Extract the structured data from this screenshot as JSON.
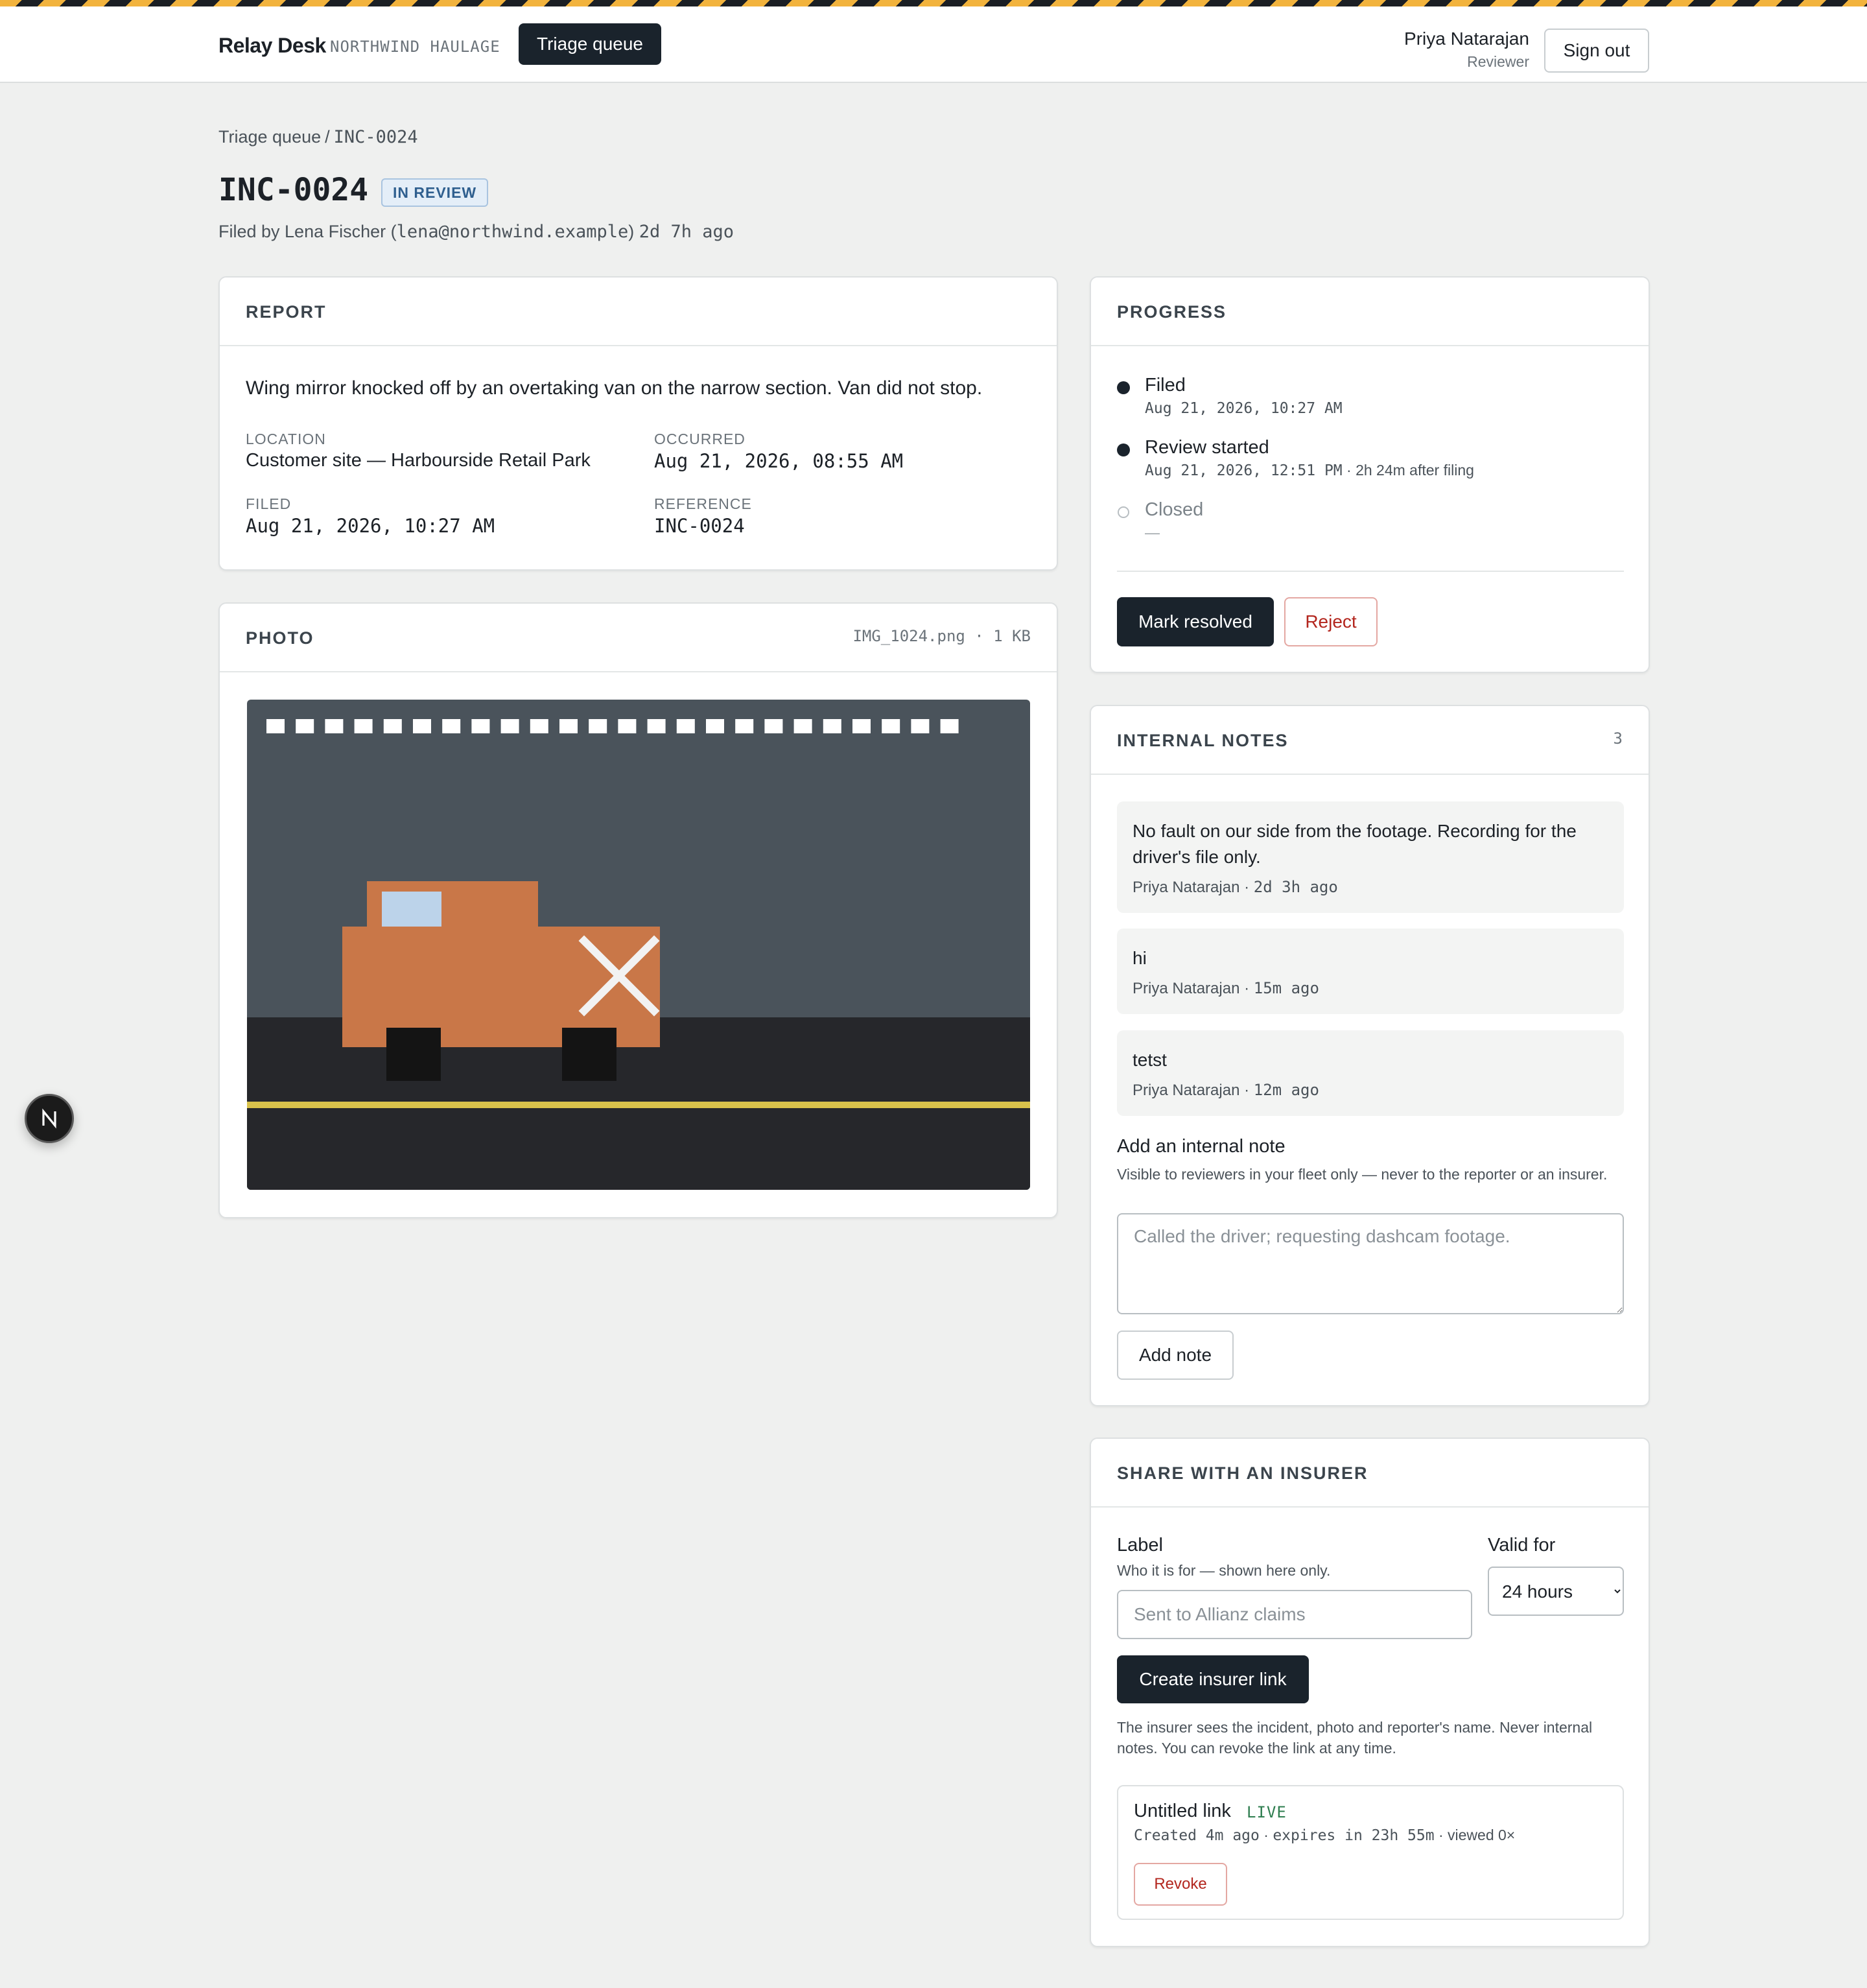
{
  "app": {
    "name": "Relay Desk",
    "org": "NORTHWIND HAULAGE"
  },
  "nav": {
    "triage_queue": "Triage queue"
  },
  "user": {
    "name": "Priya Natarajan",
    "role": "Reviewer",
    "sign_out": "Sign out"
  },
  "breadcrumb": {
    "parent": "Triage queue",
    "separator": "/",
    "current": "INC-0024"
  },
  "incident": {
    "id": "INC-0024",
    "status": "IN REVIEW",
    "filed_by_prefix": "Filed by Lena Fischer (",
    "filed_by_email": "lena@northwind.example",
    "filed_by_suffix": ")",
    "filed_ago": "2d 7h ago"
  },
  "report": {
    "heading": "REPORT",
    "description": "Wing mirror knocked off by an overtaking van on the narrow section. Van did not stop.",
    "fields": {
      "location": {
        "label": "LOCATION",
        "value": "Customer site — Harbourside Retail Park"
      },
      "occurred": {
        "label": "OCCURRED",
        "value": "Aug 21, 2026, 08:55 AM"
      },
      "filed": {
        "label": "FILED",
        "value": "Aug 21, 2026, 10:27 AM"
      },
      "reference": {
        "label": "REFERENCE",
        "value": "INC-0024"
      }
    }
  },
  "photo": {
    "heading": "PHOTO",
    "filename": "IMG_1024.png",
    "size": "1 KB",
    "meta_sep": "·"
  },
  "progress": {
    "heading": "PROGRESS",
    "steps": [
      {
        "title": "Filed",
        "timestamp": "Aug 21, 2026, 10:27 AM",
        "extra": "",
        "done": true
      },
      {
        "title": "Review started",
        "timestamp": "Aug 21, 2026, 12:51 PM",
        "extra": "· 2h 24m after filing",
        "done": true
      },
      {
        "title": "Closed",
        "timestamp": "—",
        "extra": "",
        "done": false
      }
    ],
    "mark_resolved": "Mark resolved",
    "reject": "Reject"
  },
  "notes": {
    "heading": "INTERNAL NOTES",
    "count": "3",
    "items": [
      {
        "text": "No fault on our side from the footage. Recording for the driver's file only.",
        "author": "Priya Natarajan",
        "sep": "·",
        "ago": "2d 3h ago"
      },
      {
        "text": "hi",
        "author": "Priya Natarajan",
        "sep": "·",
        "ago": "15m ago"
      },
      {
        "text": "tetst",
        "author": "Priya Natarajan",
        "sep": "·",
        "ago": "12m ago"
      }
    ],
    "add_title": "Add an internal note",
    "add_help": "Visible to reviewers in your fleet only — never to the reporter or an insurer.",
    "placeholder": "Called the driver; requesting dashcam footage.",
    "add_button": "Add note"
  },
  "share": {
    "heading": "SHARE WITH AN INSURER",
    "label_title": "Label",
    "label_help": "Who it is for — shown here only.",
    "label_placeholder": "Sent to Allianz claims",
    "valid_title": "Valid for",
    "valid_selected": "24 hours",
    "create_button": "Create insurer link",
    "help": "The insurer sees the incident, photo and reporter's name. Never internal notes. You can revoke the link at any time.",
    "links": [
      {
        "name": "Untitled link",
        "status": "LIVE",
        "created": "Created 4m ago",
        "expires": "expires in 23h 55m",
        "viewed": "viewed 0×",
        "sep": "·",
        "revoke": "Revoke"
      }
    ]
  },
  "dev_badge": {
    "letter": "N"
  },
  "colors": {
    "accent_dark": "#1a232c",
    "hazard_yellow": "#f2b33d",
    "danger": "#b3261e",
    "live_green": "#2e7d4f",
    "badge_blue": "#2f5f8f"
  },
  "icons": {
    "status_filled": "filled-dot-icon",
    "status_empty": "empty-dot-icon",
    "select_caret": "chevron-down-icon"
  }
}
